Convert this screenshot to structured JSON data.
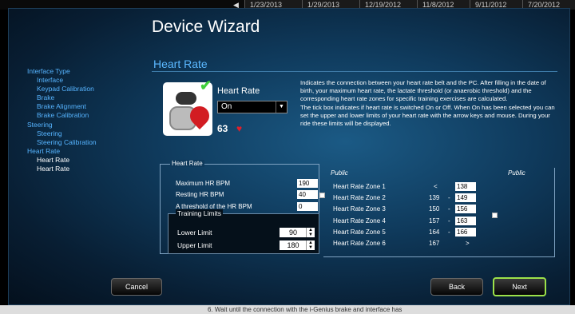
{
  "background": {
    "dates": [
      "1/23/2013",
      "1/29/2013",
      "12/19/2012",
      "11/8/2012",
      "9/11/2012",
      "7/20/2012"
    ],
    "bottom_text": "6.    Wait until the connection with the i-Genius brake and interface has"
  },
  "wizard": {
    "title": "Device Wizard",
    "nav": [
      {
        "label": "Interface Type",
        "level": 1
      },
      {
        "label": "Interface",
        "level": 2
      },
      {
        "label": "Keypad Calibration",
        "level": 2
      },
      {
        "label": "Brake",
        "level": 2
      },
      {
        "label": "Brake Alignment",
        "level": 2
      },
      {
        "label": "Brake Calibration",
        "level": 2
      },
      {
        "label": "Steering",
        "level": 1
      },
      {
        "label": "Steering",
        "level": 2
      },
      {
        "label": "Steering Calibration",
        "level": 2
      },
      {
        "label": "Heart Rate",
        "level": 1
      },
      {
        "label": "Heart Rate",
        "level": 2
      },
      {
        "label": "Heart Rate",
        "level": 2,
        "active": true
      }
    ],
    "section_title": "Heart Rate",
    "card": {
      "label": "Heart Rate",
      "select_value": "On",
      "heart_rate": "63"
    },
    "description": "Indicates the connection between your heart rate belt and the PC. After filling in the date of birth, your maximum heart rate, the lactate threshold (or anaerobic threshold) and the corresponding heart rate zones for specific training exercises are calculated.\nThe tick box indicates if heart rate is switched On or Off. When On has been selected you can set the upper and lower limits of your heart rate with the arrow keys and mouse. During your ride these limits will be displayed.",
    "hr_panel": {
      "title": "Heart Rate",
      "fields": [
        {
          "label": "Maximum HR BPM",
          "value": "190"
        },
        {
          "label": "Resting HR BPM",
          "value": "40"
        },
        {
          "label": "A threshold of the HR BPM",
          "value": "0"
        }
      ],
      "training": {
        "title": "Training Limits",
        "lower_label": "Lower Limit",
        "lower_value": "90",
        "upper_label": "Upper Limit",
        "upper_value": "180"
      }
    },
    "zones": {
      "public_label": "Public",
      "items": [
        {
          "label": "Heart Rate Zone 1",
          "from": "",
          "sep": "<",
          "to": "138"
        },
        {
          "label": "Heart Rate Zone 2",
          "from": "139",
          "sep": "-",
          "to": "149"
        },
        {
          "label": "Heart Rate Zone 3",
          "from": "150",
          "sep": "-",
          "to": "156"
        },
        {
          "label": "Heart Rate Zone 4",
          "from": "157",
          "sep": "-",
          "to": "163"
        },
        {
          "label": "Heart Rate Zone 5",
          "from": "164",
          "sep": "-",
          "to": "166"
        },
        {
          "label": "Heart Rate Zone 6",
          "from": "167",
          "sep": ">",
          "to": ""
        }
      ]
    },
    "buttons": {
      "cancel": "Cancel",
      "back": "Back",
      "next": "Next"
    }
  }
}
